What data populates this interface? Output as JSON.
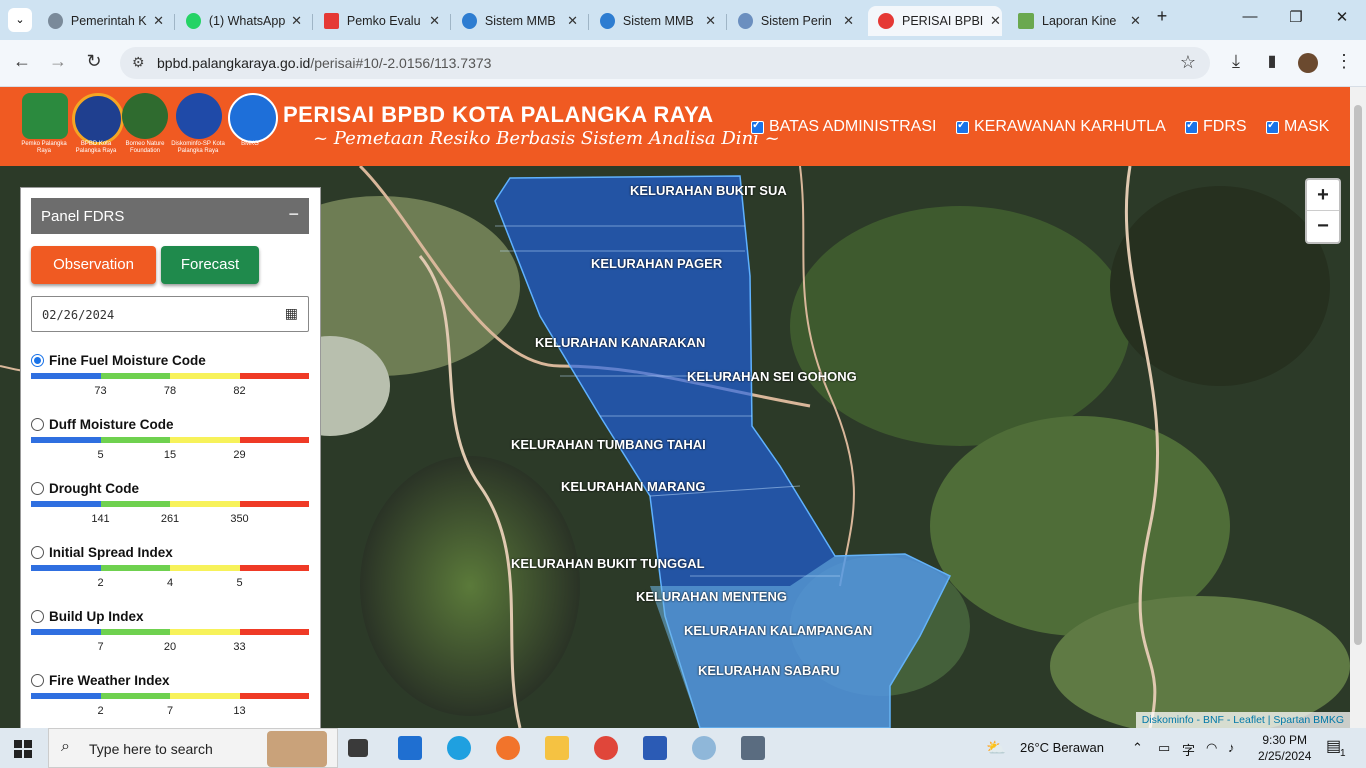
{
  "browser": {
    "tabs": [
      {
        "title": "Pemerintah K",
        "color": "#5a6a7a"
      },
      {
        "title": "(1) WhatsApp",
        "color": "#25d366"
      },
      {
        "title": "Pemko Evalu",
        "color": "#e53935"
      },
      {
        "title": "Sistem MMB",
        "color": "#2e7dd1"
      },
      {
        "title": "Sistem MMB",
        "color": "#2e7dd1"
      },
      {
        "title": "Sistem Perin",
        "color": "#6b8fbf"
      },
      {
        "title": "PERISAI BPBI",
        "color": "#e53935"
      },
      {
        "title": "Laporan Kine",
        "color": "#6aa84f"
      }
    ],
    "url_host": "bpbd.palangkaraya.go.id",
    "url_path": "/perisai#10/-2.0156/113.7373"
  },
  "header": {
    "title": "PERISAI BPBD KOTA PALANGKA RAYA",
    "subtitle": "~ Pemetaan Resiko Berbasis Sistem Analisa Dini ~",
    "logos": [
      {
        "label": "Pemko Palangka Raya",
        "color": "#2b8a3e"
      },
      {
        "label": "BPBD Kota Palangka Raya",
        "color": "#1f3f8f"
      },
      {
        "label": "Borneo Nature Foundation",
        "color": "#2f6b2f"
      },
      {
        "label": "Diskominfo-SP Kota Palangka Raya",
        "color": "#1f4aa8"
      },
      {
        "label": "BMKG",
        "color": "#1e6fd9"
      }
    ],
    "layers": [
      "BATAS ADMINISTRASI",
      "KERAWANAN KARHUTLA",
      "FDRS",
      "MASK"
    ]
  },
  "map": {
    "kelurahan": [
      "KELURAHAN BUKIT SUA",
      "KELURAHAN PAGER",
      "KELURAHAN KANARAKAN",
      "KELURAHAN SEI GOHONG",
      "KELURAHAN TUMBANG TAHAI",
      "KELURAHAN MARANG",
      "KELURAHAN BUKIT TUNGGAL",
      "KELURAHAN MENTENG",
      "KELURAHAN KALAMPANGAN",
      "KELURAHAN SABARU"
    ],
    "attribution": "Diskominfo - BNF - Leaflet | Spartan BMKG",
    "zoom_in": "+",
    "zoom_out": "−"
  },
  "panel": {
    "title": "Panel FDRS",
    "collapse": "−",
    "observation": "Observation",
    "forecast": "Forecast",
    "date": "02/26/2024",
    "indices": [
      {
        "label": "Fine Fuel Moisture Code",
        "ticks": [
          "73",
          "78",
          "82"
        ],
        "selected": true
      },
      {
        "label": "Duff Moisture Code",
        "ticks": [
          "5",
          "15",
          "29"
        ],
        "selected": false
      },
      {
        "label": "Drought Code",
        "ticks": [
          "141",
          "261",
          "350"
        ],
        "selected": false
      },
      {
        "label": "Initial Spread Index",
        "ticks": [
          "2",
          "4",
          "5"
        ],
        "selected": false
      },
      {
        "label": "Build Up Index",
        "ticks": [
          "7",
          "20",
          "33"
        ],
        "selected": false
      },
      {
        "label": "Fire Weather Index",
        "ticks": [
          "2",
          "7",
          "13"
        ],
        "selected": false
      }
    ]
  },
  "taskbar": {
    "search_placeholder": "Type here to search",
    "weather": "26°C  Berawan",
    "time": "9:30 PM",
    "date": "2/25/2024",
    "notifications": "1"
  }
}
